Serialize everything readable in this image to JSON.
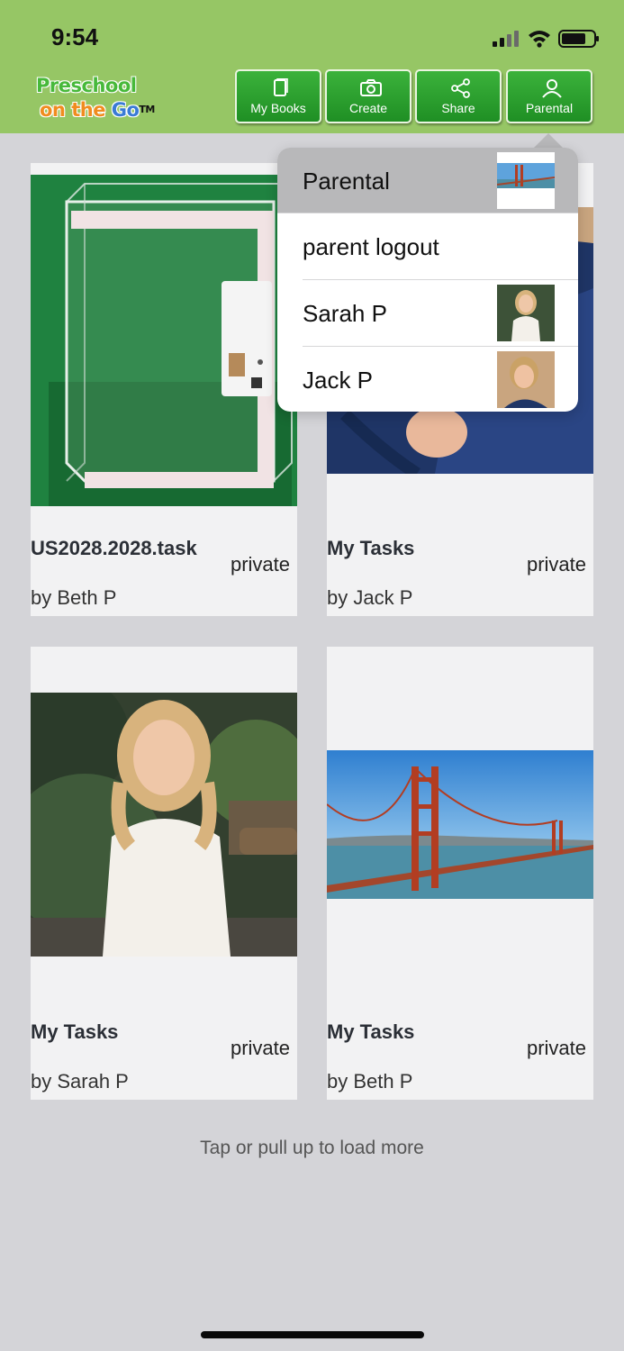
{
  "status_bar": {
    "time": "9:54"
  },
  "logo": {
    "line1": "Preschool",
    "on": "on",
    "the": "the",
    "go": "Go",
    "tm": "TM"
  },
  "nav": {
    "my_books": "My Books",
    "create": "Create",
    "share": "Share",
    "parental": "Parental"
  },
  "cards": [
    {
      "title": "US2028.2028.task",
      "privacy": "private",
      "author": "by Beth P"
    },
    {
      "title": "My Tasks",
      "privacy": "private",
      "author": "by Jack P"
    },
    {
      "title": "My Tasks",
      "privacy": "private",
      "author": "by Sarah P"
    },
    {
      "title": "My Tasks",
      "privacy": "private",
      "author": "by Beth P"
    }
  ],
  "load_more": "Tap or pull up to load more",
  "dropdown": {
    "items": [
      {
        "label": "Parental"
      },
      {
        "label": "parent logout"
      },
      {
        "label": "Sarah P"
      },
      {
        "label": "Jack P"
      }
    ]
  },
  "colors": {
    "header": "#96c665",
    "nav_button": "#2aa12e",
    "background": "#d4d4d8",
    "card": "#f2f2f3"
  }
}
